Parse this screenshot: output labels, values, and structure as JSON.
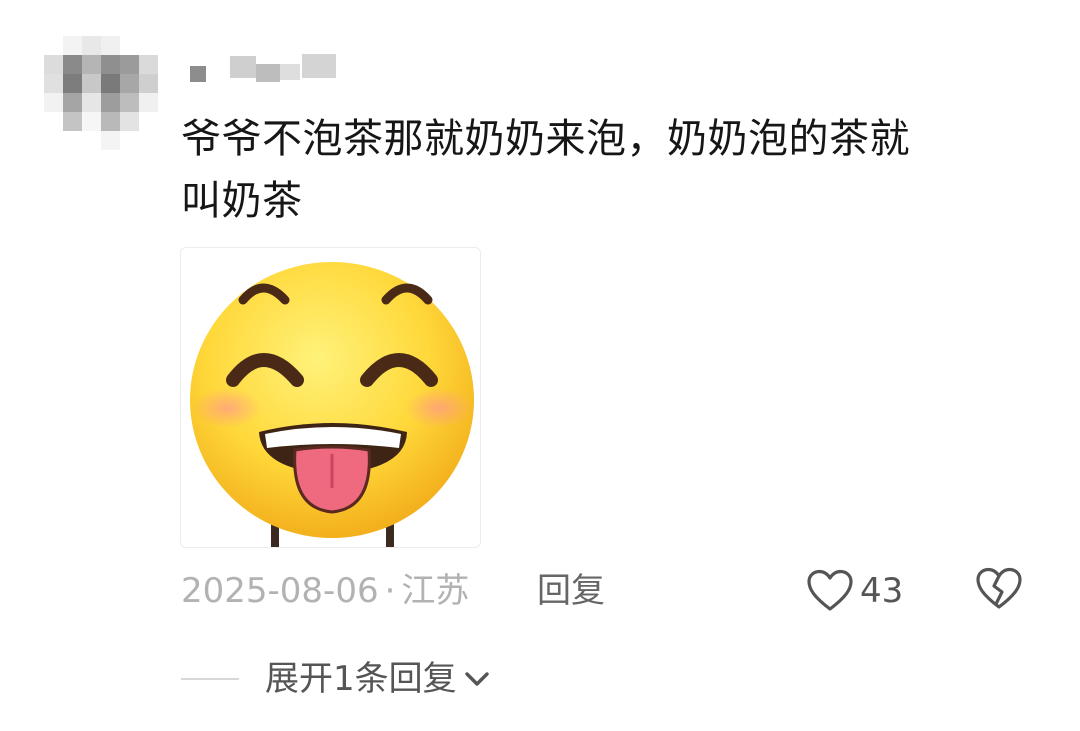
{
  "comment": {
    "text_line1": "爷爷不泡茶那就奶奶来泡，奶奶泡的茶就",
    "text_line2": "叫奶茶",
    "sticker_icon": "laughing-tongue-emoji-icon"
  },
  "meta": {
    "date": "2025-08-06",
    "separator": "·",
    "location": "江苏"
  },
  "actions": {
    "reply_label": "回复",
    "like_count": "43",
    "like_icon": "heart-outline-icon",
    "dislike_icon": "broken-heart-icon"
  },
  "replies": {
    "expand_label": "展开1条回复",
    "expand_icon": "chevron-down-icon"
  },
  "colors": {
    "text": "#161616",
    "meta": "#b2b2b2",
    "action": "#555555"
  }
}
